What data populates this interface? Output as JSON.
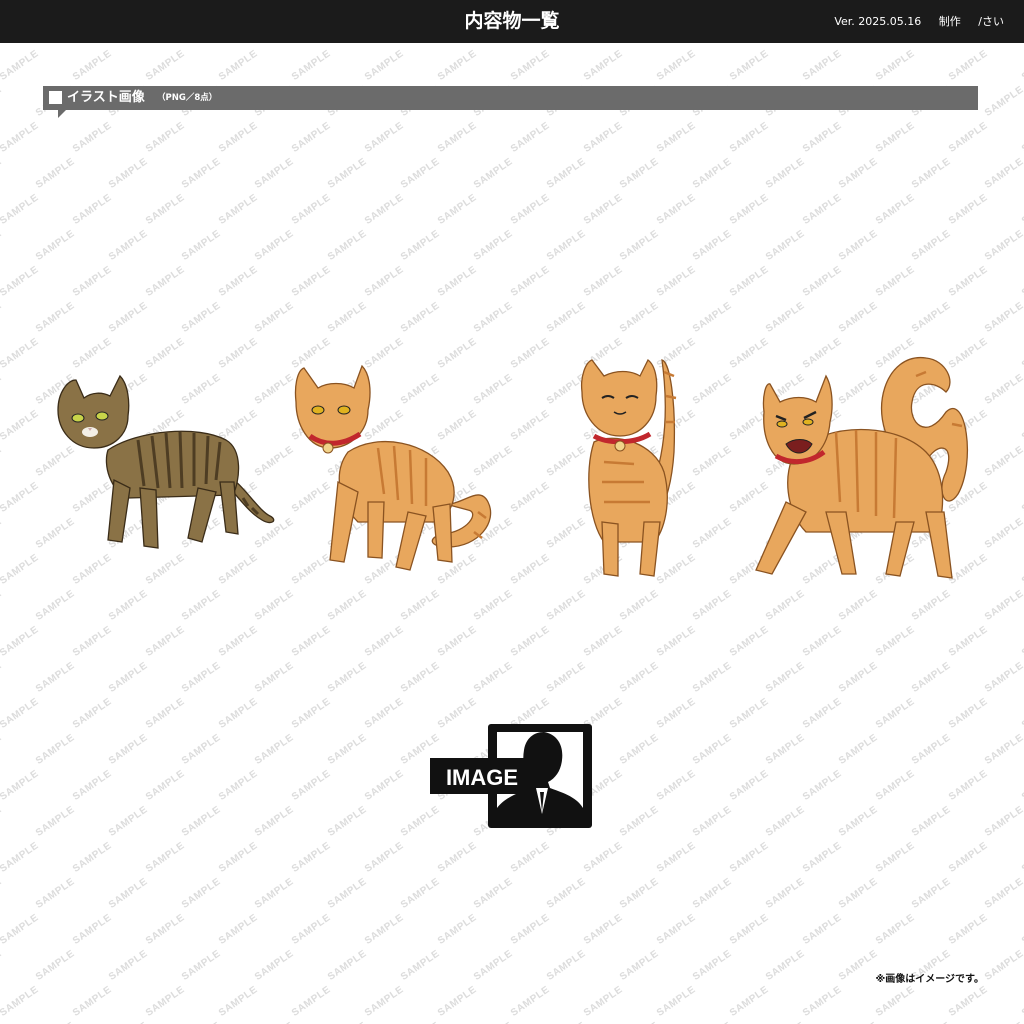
{
  "header": {
    "title": "内容物一覧",
    "version": "Ver. 2025.05.16",
    "credit_label": "制作",
    "credit_name": "/さい"
  },
  "section": {
    "title": "イラスト画像",
    "subtitle": "（PNG／8点）"
  },
  "watermark": "SAMPLE",
  "illustrations": [
    {
      "name": "brown-tabby-cat-standing",
      "color": "#8a7246"
    },
    {
      "name": "orange-tabby-cat-red-collar",
      "color": "#e8a75d"
    },
    {
      "name": "orange-tabby-cat-smiling-tail-up",
      "color": "#e8a75d"
    },
    {
      "name": "orange-tabby-cat-hissing",
      "color": "#e8a75d"
    }
  ],
  "image_logo": {
    "label": "IMAGE"
  },
  "footnote": "※画像はイメージです。",
  "colors": {
    "header_bg": "#1b1b1b",
    "section_bg": "#6b6b6b",
    "collar": "#c1272d"
  }
}
